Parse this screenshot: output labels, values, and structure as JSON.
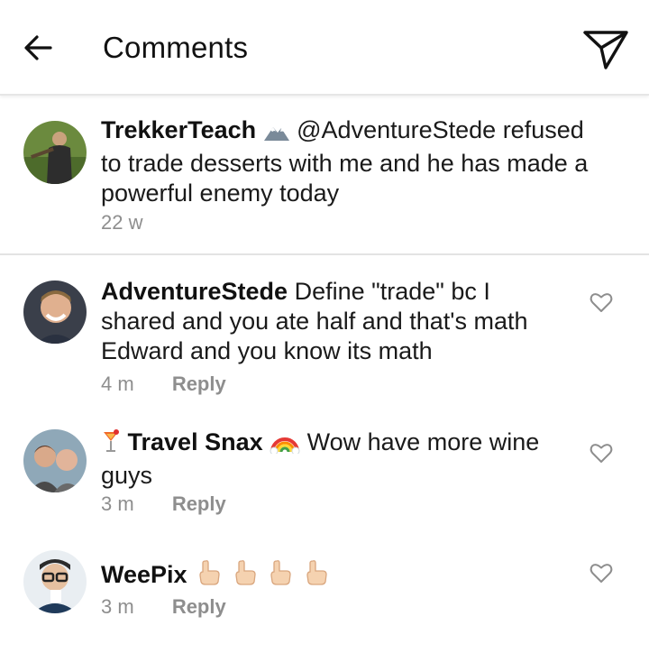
{
  "header": {
    "title": "Comments",
    "back_icon": "arrow-left-icon",
    "send_icon": "paper-plane-icon"
  },
  "caption": {
    "username": "TrekkerTeach",
    "badge_icon": "mountain-emoji",
    "text": " @AdventureStede refused to trade desserts with me and he has made a powerful enemy today",
    "time": "22 w"
  },
  "comments": [
    {
      "username": "AdventureStede",
      "text": " Define \"trade\" bc I shared and you ate half and that's math Edward and you know its math",
      "time": "4 m",
      "reply_label": "Reply"
    },
    {
      "username_prefix_icon": "cocktail-emoji",
      "username": "Travel Snax",
      "username_suffix_icon": "rainbow-emoji",
      "text": " Wow have more wine guys",
      "time": "3 m",
      "reply_label": "Reply"
    },
    {
      "username": "WeePix",
      "suffix_icons": [
        "pointing-up-emoji",
        "pointing-up-emoji",
        "pointing-up-emoji",
        "pointing-up-emoji"
      ],
      "time": "3 m",
      "reply_label": "Reply"
    }
  ],
  "colors": {
    "meta_gray": "#8e8e8e",
    "divider": "#e3e3e3"
  }
}
